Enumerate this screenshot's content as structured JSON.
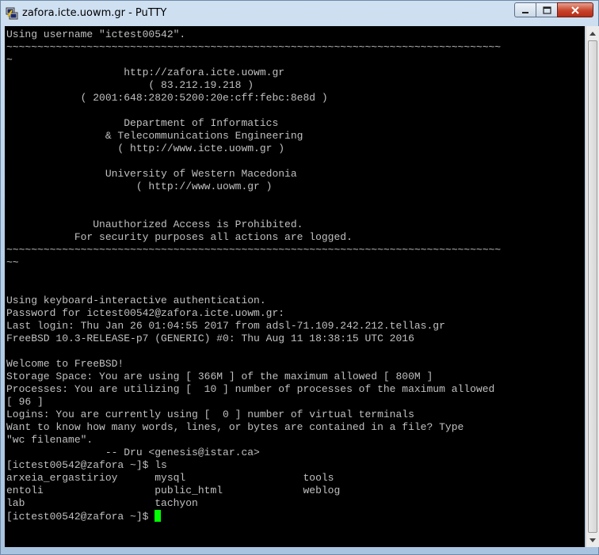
{
  "window": {
    "title": "zafora.icte.uowm.gr - PuTTY"
  },
  "terminal": {
    "lines": [
      "Using username \"ictest00542\".",
      "~~~~~~~~~~~~~~~~~~~~~~~~~~~~~~~~~~~~~~~~~~~~~~~~~~~~~~~~~~~~~~~~~~~~~~~~~~~~~~~~",
      "~",
      "                   http://zafora.icte.uowm.gr",
      "                       ( 83.212.19.218 )",
      "            ( 2001:648:2820:5200:20e:cff:febc:8e8d )",
      "",
      "                   Department of Informatics",
      "                & Telecommunications Engineering",
      "                  ( http://www.icte.uowm.gr )",
      "",
      "                University of Western Macedonia",
      "                     ( http://www.uowm.gr )",
      "",
      "",
      "              Unauthorized Access is Prohibited.",
      "           For security purposes all actions are logged.",
      "~~~~~~~~~~~~~~~~~~~~~~~~~~~~~~~~~~~~~~~~~~~~~~~~~~~~~~~~~~~~~~~~~~~~~~~~~~~~~~~~",
      "~~",
      "",
      "",
      "Using keyboard-interactive authentication.",
      "Password for ictest00542@zafora.icte.uowm.gr:",
      "Last login: Thu Jan 26 01:04:55 2017 from adsl-71.109.242.212.tellas.gr",
      "FreeBSD 10.3-RELEASE-p7 (GENERIC) #0: Thu Aug 11 18:38:15 UTC 2016",
      "",
      "Welcome to FreeBSD!",
      "Storage Space: You are using [ 366M ] of the maximum allowed [ 800M ]",
      "Processes: You are utilizing [  10 ] number of processes of the maximum allowed",
      "[ 96 ]",
      "Logins: You are currently using [  0 ] number of virtual terminals",
      "Want to know how many words, lines, or bytes are contained in a file? Type",
      "\"wc filename\".",
      "                -- Dru <genesis@istar.ca>",
      "[ictest00542@zafora ~]$ ls",
      "arxeia_ergastirioy      mysql                   tools",
      "entoli                  public_html             weblog",
      "lab                     tachyon"
    ],
    "prompt": "[ictest00542@zafora ~]$ ",
    "colors": {
      "background": "#000000",
      "foreground": "#c0c0c0",
      "cursor": "#00ff00"
    }
  },
  "icons": {
    "app": "putty-icon",
    "minimize": "minimize-icon",
    "maximize": "maximize-icon",
    "close": "close-icon",
    "scroll_up": "arrow-up-icon",
    "scroll_down": "arrow-down-icon"
  }
}
